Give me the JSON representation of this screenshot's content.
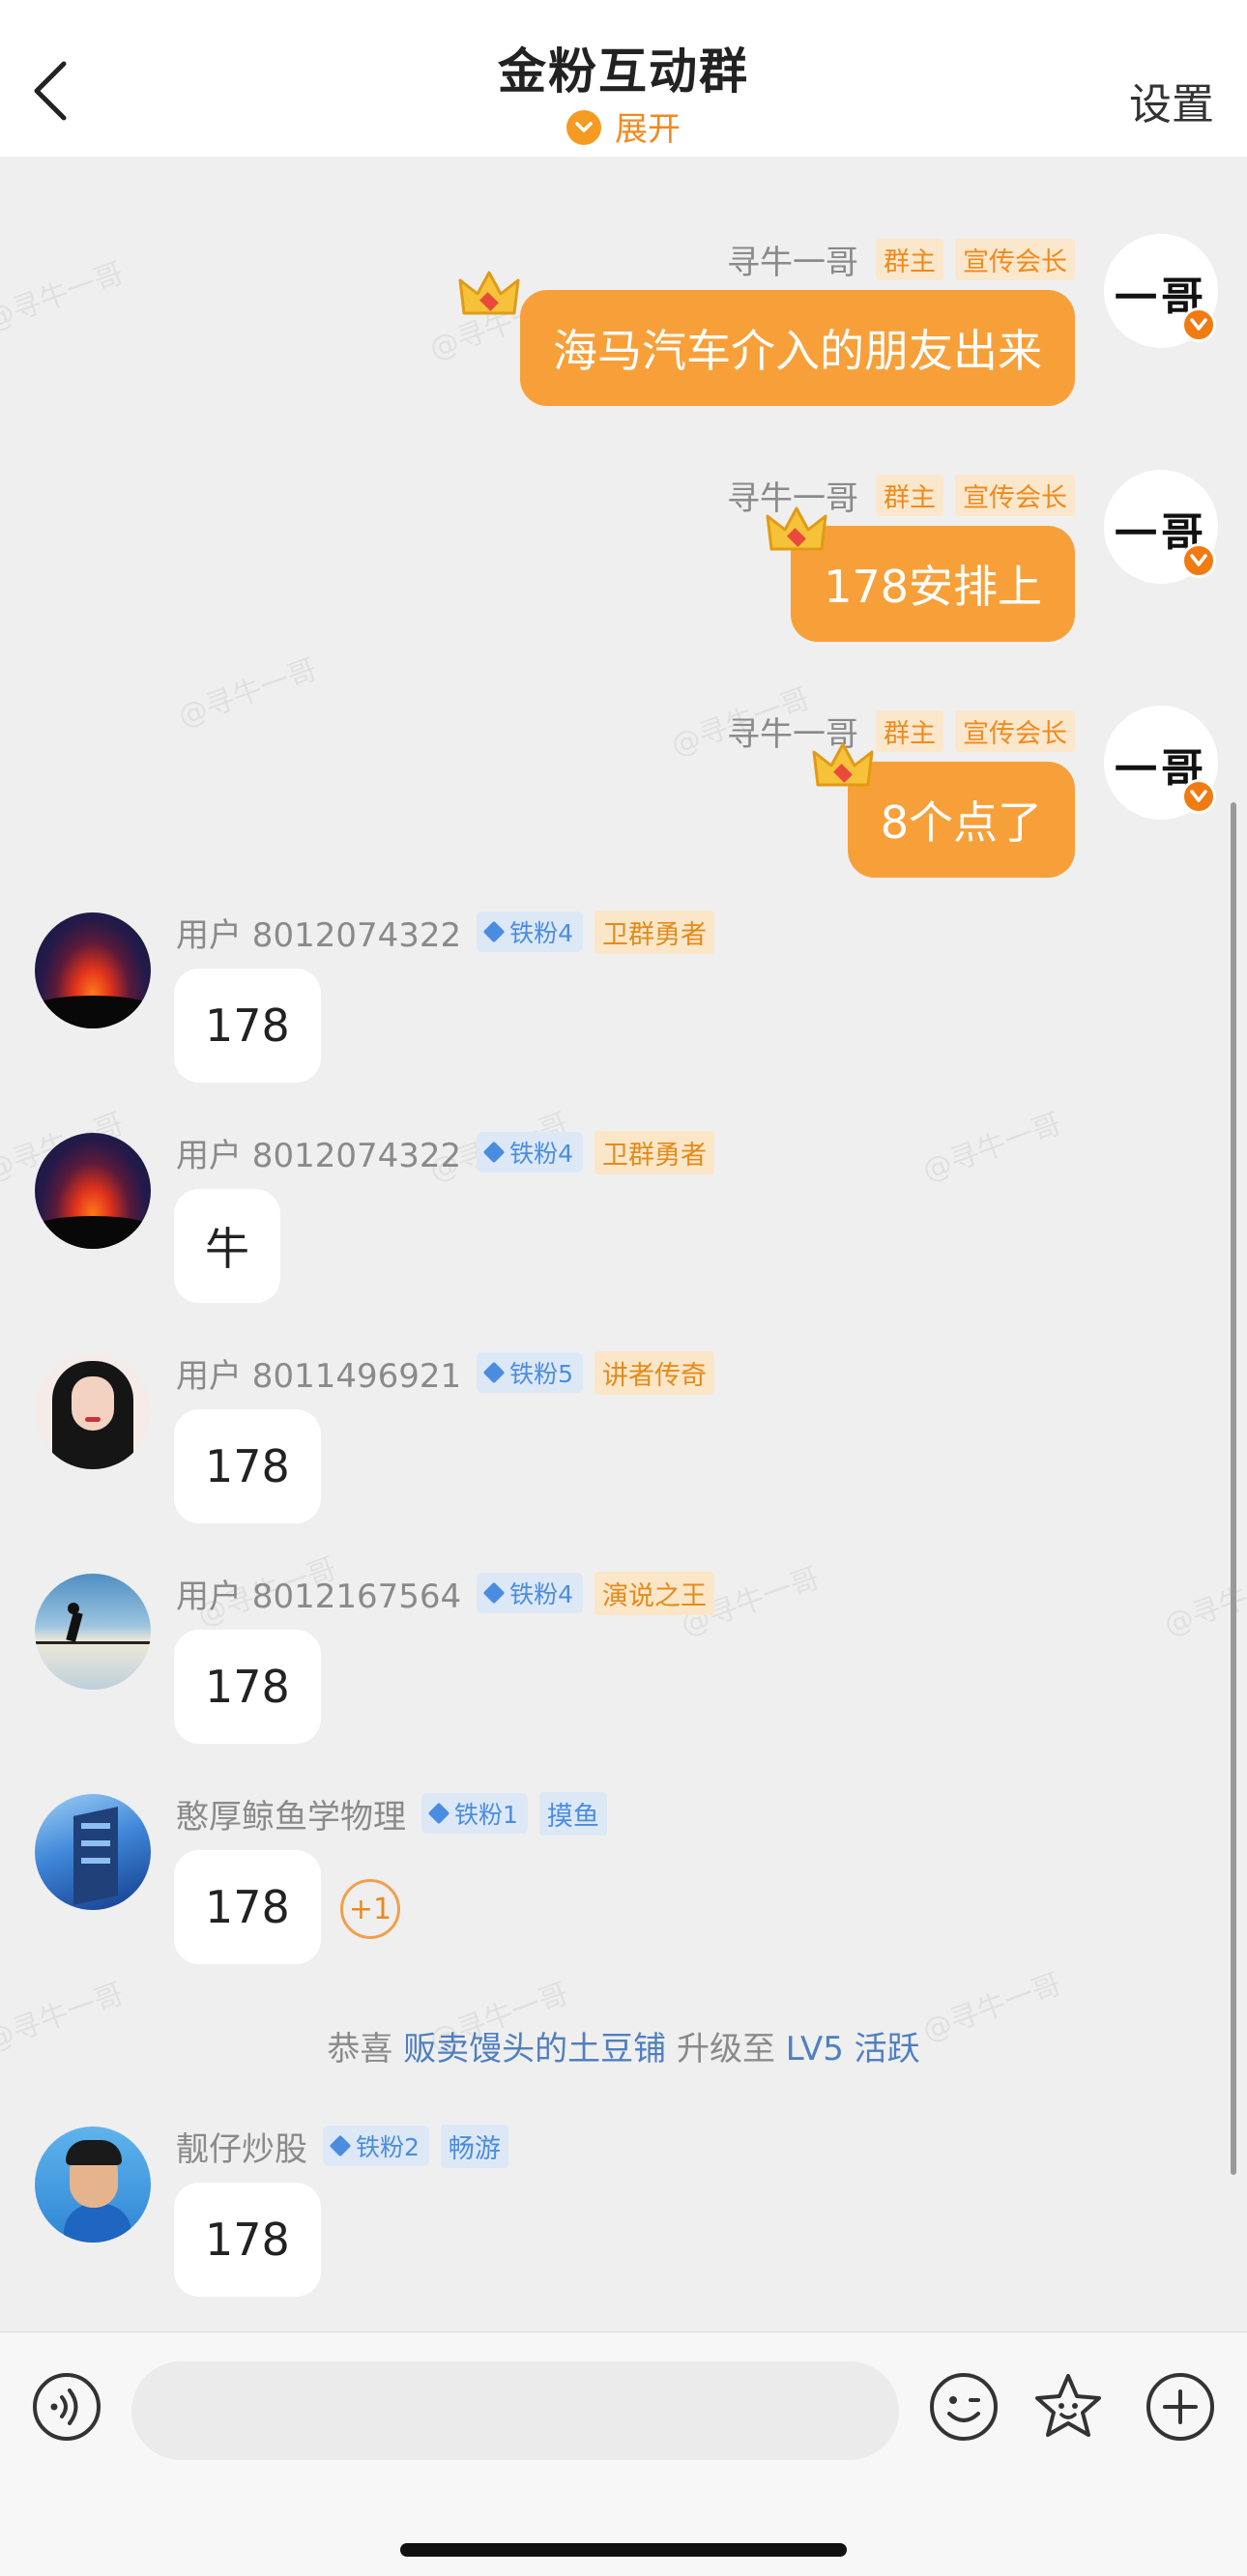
{
  "header": {
    "title": "金粉互动群",
    "expand_label": "展开",
    "settings_label": "设置"
  },
  "colors": {
    "accent": "#f7a03a",
    "fan_tag": "#4a8de0",
    "link": "#4f7fc0"
  },
  "outgoing": [
    {
      "name": "寻牛一哥",
      "tags": [
        "群主",
        "宣传会长"
      ],
      "text": "海马汽车介入的朋友出来",
      "avatar_text": "一哥"
    },
    {
      "name": "寻牛一哥",
      "tags": [
        "群主",
        "宣传会长"
      ],
      "text": "178安排上",
      "avatar_text": "一哥"
    },
    {
      "name": "寻牛一哥",
      "tags": [
        "群主",
        "宣传会长"
      ],
      "text": "8个点了",
      "avatar_text": "一哥"
    }
  ],
  "incoming": [
    {
      "name": "用户 8012074322",
      "fan": "铁粉4",
      "title": "卫群勇者",
      "text": "178"
    },
    {
      "name": "用户 8012074322",
      "fan": "铁粉4",
      "title": "卫群勇者",
      "text": "牛"
    },
    {
      "name": "用户 8011496921",
      "fan": "铁粉5",
      "title": "讲者传奇",
      "text": "178"
    },
    {
      "name": "用户 8012167564",
      "fan": "铁粉4",
      "title": "演说之王",
      "text": "178"
    },
    {
      "name": "憨厚鲸鱼学物理",
      "fan": "铁粉1",
      "title": "摸鱼",
      "text": "178",
      "reaction": "+1"
    },
    {
      "name": "靓仔炒股",
      "fan": "铁粉2",
      "title": "畅游",
      "text": "178"
    }
  ],
  "system_message": {
    "prefix": "恭喜",
    "user": "贩卖馒头的土豆铺",
    "middle": "升级至",
    "level": "LV5 活跃"
  },
  "watermark": "@寻牛一哥",
  "bottom_bar": {
    "icons": [
      "voice-icon",
      "emoji-icon",
      "sticker-icon",
      "plus-icon"
    ],
    "input_placeholder": ""
  }
}
